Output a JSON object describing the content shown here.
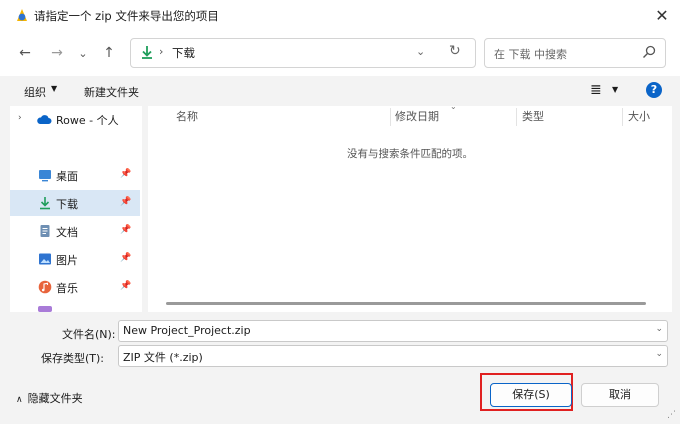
{
  "window": {
    "title": "请指定一个 zip 文件来导出您的项目",
    "close_glyph": "✕"
  },
  "nav": {
    "back_glyph": "←",
    "forward_glyph": "→",
    "recent_glyph": "⌄",
    "up_glyph": "↑",
    "breadcrumb_separator": "›",
    "breadcrumb": "下载",
    "address_dropdown_glyph": "⌄",
    "refresh_glyph": "↻",
    "search_placeholder": "在 下载 中搜索"
  },
  "toolbar": {
    "organize_label": "组织",
    "organize_caret": "▼",
    "new_folder_label": "新建文件夹",
    "view_glyph": "≣",
    "view_caret": "▼",
    "help_glyph": "?"
  },
  "sidebar": {
    "onedrive": {
      "chevron": "›",
      "label": "Rowe - 个人",
      "icon": "cloud-icon"
    },
    "items": [
      {
        "label": "桌面",
        "icon": "desktop-icon",
        "pin": "📌",
        "selected": false
      },
      {
        "label": "下载",
        "icon": "download-icon",
        "pin": "📌",
        "selected": true
      },
      {
        "label": "文档",
        "icon": "document-icon",
        "pin": "📌",
        "selected": false
      },
      {
        "label": "图片",
        "icon": "picture-icon",
        "pin": "📌",
        "selected": false
      },
      {
        "label": "音乐",
        "icon": "music-icon",
        "pin": "📌",
        "selected": false
      }
    ]
  },
  "filelist": {
    "columns": [
      "名称",
      "修改日期",
      "类型",
      "大小"
    ],
    "sort_caret": "⌄",
    "empty_message": "没有与搜索条件匹配的项。"
  },
  "form": {
    "filename_label": "文件名(N):",
    "filename_value": "New Project_Project.zip",
    "filename_dropdown_glyph": "⌄",
    "filetype_label": "保存类型(T):",
    "filetype_value": "ZIP 文件 (*.zip)",
    "filetype_dropdown_glyph": "⌄"
  },
  "footer": {
    "hide_folders_caret": "∧",
    "hide_folders_label": "隐藏文件夹",
    "save_label": "保存(S)",
    "cancel_label": "取消",
    "resize_glyph": "⋰"
  },
  "colors": {
    "accent": "#0a64c8",
    "selection": "#d9e7f5",
    "highlight_box": "#e02020",
    "download_arrow": "#1f9e5b"
  }
}
